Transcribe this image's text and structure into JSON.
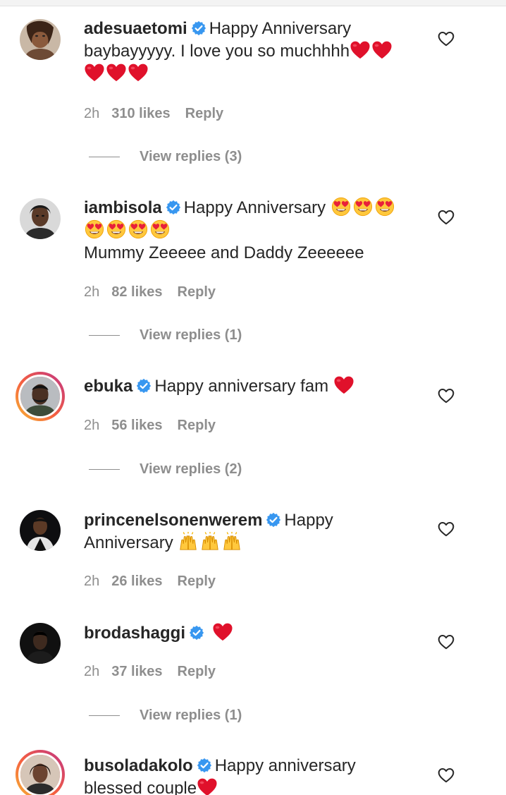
{
  "comments": [
    {
      "username": "adesuaetomi",
      "text": "Happy Anniversary baybayyyyy. I love you so muchhhh",
      "time": "2h",
      "likes": "310 likes",
      "reply": "Reply",
      "view_replies": "View replies (3)"
    },
    {
      "username": "iambisola",
      "text": "Happy Anniversary",
      "text2": "Mummy Zeeeee and Daddy Zeeeeee",
      "time": "2h",
      "likes": "82 likes",
      "reply": "Reply",
      "view_replies": "View replies (1)"
    },
    {
      "username": "ebuka",
      "text": "Happy anniversary fam",
      "time": "2h",
      "likes": "56 likes",
      "reply": "Reply",
      "view_replies": "View replies (2)"
    },
    {
      "username": "princenelsonenwerem",
      "text": "Happy",
      "text2": "Anniversary",
      "time": "2h",
      "likes": "26 likes",
      "reply": "Reply"
    },
    {
      "username": "brodashaggi",
      "time": "2h",
      "likes": "37 likes",
      "reply": "Reply",
      "view_replies": "View replies (1)"
    },
    {
      "username": "busoladakolo",
      "text": "Happy anniversary",
      "text2": "blessed couple"
    }
  ],
  "colors": {
    "verified_blue": "#3897f0",
    "heart_red": "#e0112b",
    "muted_text": "#8e8e8e",
    "story_ring": "#c13584"
  },
  "icons": {
    "verified": "verified-badge-icon",
    "like": "heart-outline-icon",
    "red_heart": "red-heart-emoji",
    "heart_eyes": "heart-eyes-emoji",
    "raised_hands": "raised-hands-emoji"
  }
}
